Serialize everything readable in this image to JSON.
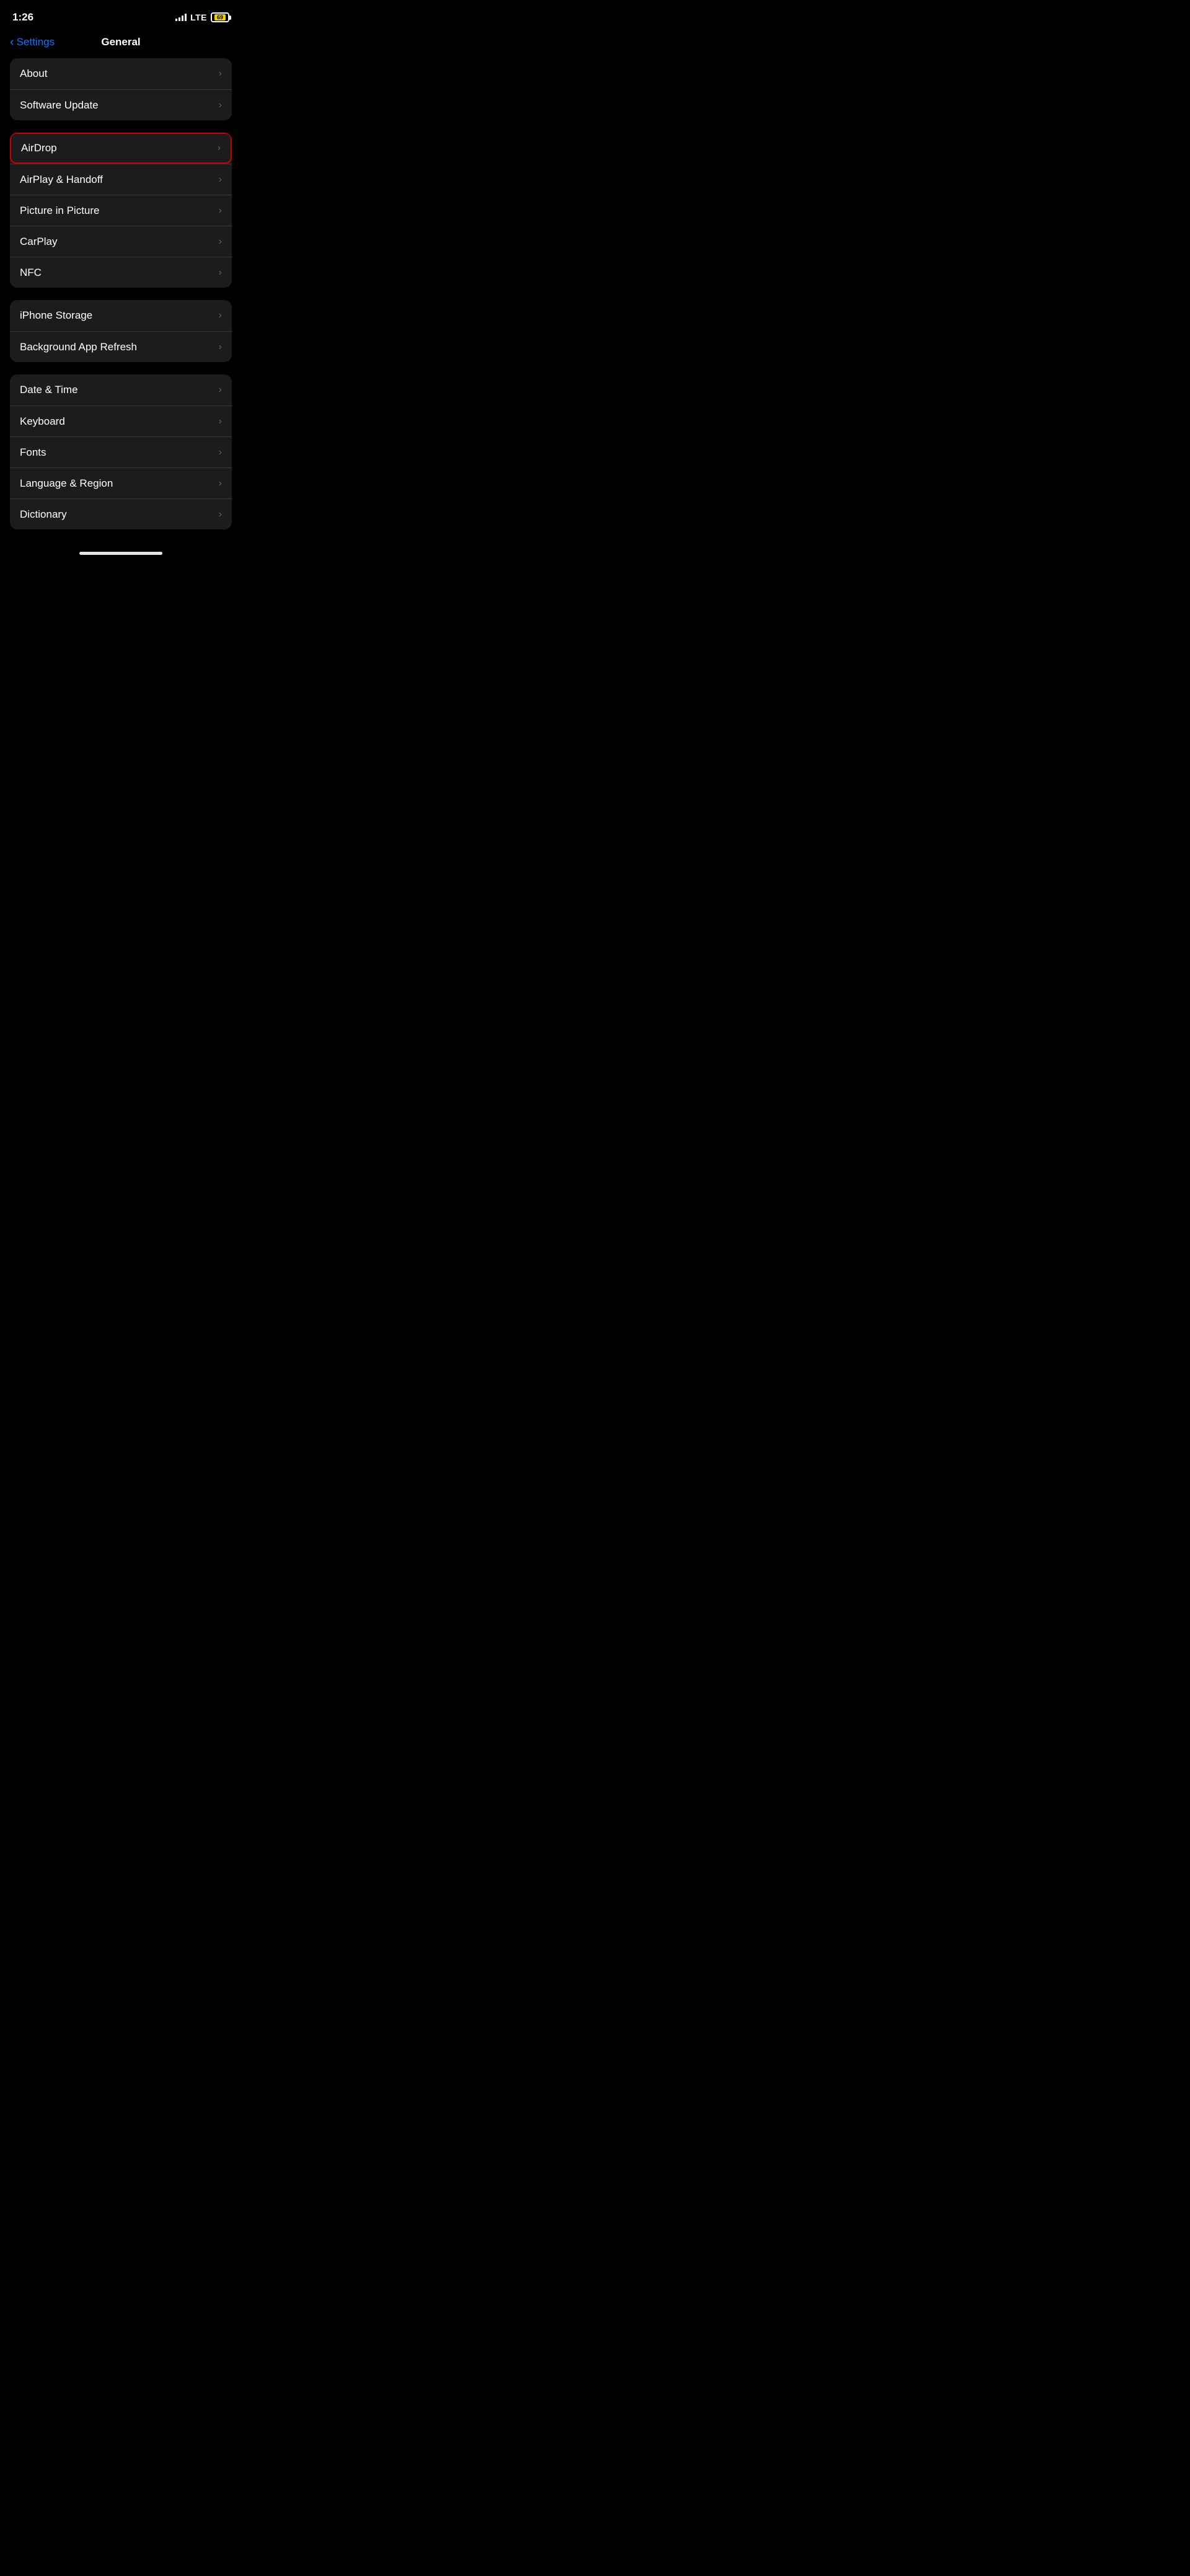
{
  "statusBar": {
    "time": "1:26",
    "lte": "LTE",
    "battery": "69"
  },
  "navBar": {
    "backLabel": "Settings",
    "title": "General"
  },
  "groups": [
    {
      "id": "group1",
      "items": [
        {
          "id": "about",
          "label": "About",
          "highlighted": false
        },
        {
          "id": "software-update",
          "label": "Software Update",
          "highlighted": false
        }
      ]
    },
    {
      "id": "group2",
      "items": [
        {
          "id": "airdrop",
          "label": "AirDrop",
          "highlighted": true
        },
        {
          "id": "airplay-handoff",
          "label": "AirPlay & Handoff",
          "highlighted": false
        },
        {
          "id": "picture-in-picture",
          "label": "Picture in Picture",
          "highlighted": false
        },
        {
          "id": "carplay",
          "label": "CarPlay",
          "highlighted": false
        },
        {
          "id": "nfc",
          "label": "NFC",
          "highlighted": false
        }
      ]
    },
    {
      "id": "group3",
      "items": [
        {
          "id": "iphone-storage",
          "label": "iPhone Storage",
          "highlighted": false
        },
        {
          "id": "background-app-refresh",
          "label": "Background App Refresh",
          "highlighted": false
        }
      ]
    },
    {
      "id": "group4",
      "items": [
        {
          "id": "date-time",
          "label": "Date & Time",
          "highlighted": false
        },
        {
          "id": "keyboard",
          "label": "Keyboard",
          "highlighted": false
        },
        {
          "id": "fonts",
          "label": "Fonts",
          "highlighted": false
        },
        {
          "id": "language-region",
          "label": "Language & Region",
          "highlighted": false
        },
        {
          "id": "dictionary",
          "label": "Dictionary",
          "highlighted": false
        }
      ]
    }
  ]
}
